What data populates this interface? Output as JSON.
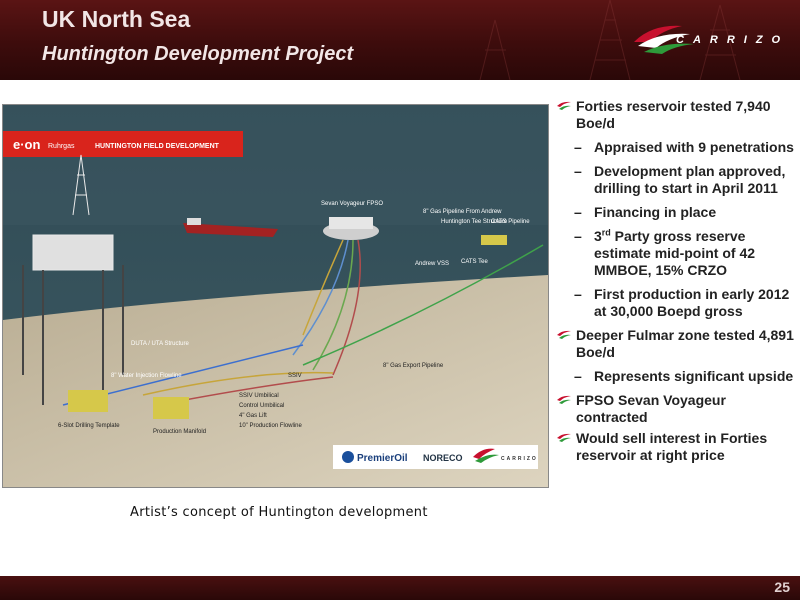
{
  "header": {
    "title": "UK North Sea",
    "subtitle": "Huntington Development Project",
    "logo_text": "CARRIZO"
  },
  "scene": {
    "banner_brand": "e·on",
    "banner_brand_sub": "Ruhrgas",
    "banner_title": "HUNTINGTON FIELD DEVELOPMENT",
    "labels": {
      "fpso": "Sevan Voyageur FPSO",
      "gas_pipeline_andrew": "8\" Gas Pipeline From Andrew",
      "huntington_tee": "Huntington Tee Structure",
      "cats_pipeline": "CATS Pipeline",
      "andrew_vss": "Andrew VSS",
      "cats_tee": "CATS Tee",
      "duta": "DUTA / UTA Structure",
      "water_injection": "8\" Water Injection Flowline",
      "gas_export": "8\" Gas Export Pipeline",
      "ssiv": "SSIV",
      "ssiv_umbilical": "SSIV Umbilical",
      "control_umbilical": "Control Umbilical",
      "gas_lift": "4\" Gas Lift",
      "production_flowline": "10\" Production Flowline",
      "drilling_template": "6-Slot Drilling Template",
      "production_manifold": "Production Manifold"
    },
    "partner_logos": [
      "PremierOil",
      "NORECO",
      "CARRIZO"
    ],
    "caption": "Artist’s concept of Huntington development"
  },
  "bullets": [
    {
      "text": "Forties reservoir tested 7,940 Boe/d",
      "sub": [
        "Appraised with 9 penetrations",
        "Development plan approved, drilling to start in April 2011",
        "Financing in place",
        "3rd Party gross reserve estimate mid-point of 42 MMBOE, 15% CRZO",
        "First production in early 2012 at 30,000 Boepd gross"
      ]
    },
    {
      "text": "Deeper Fulmar zone tested 4,891 Boe/d",
      "sub": [
        "Represents significant upside"
      ]
    },
    {
      "text": "FPSO Sevan Voyageur contracted",
      "sub": []
    },
    {
      "text": "Would sell interest in Forties reservoir at right price",
      "sub": []
    }
  ],
  "footer": {
    "page_number": "25"
  },
  "colors": {
    "brand_red": "#c8102e",
    "brand_green": "#2e7d32",
    "header_bg": "#3d0c0c"
  }
}
